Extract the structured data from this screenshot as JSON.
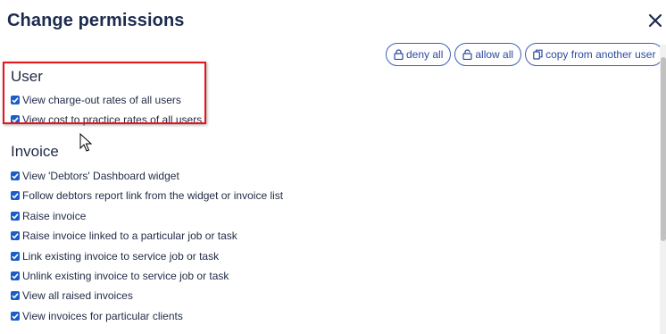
{
  "dialog": {
    "title": "Change permissions",
    "close_icon": "close-icon"
  },
  "toolbar": {
    "deny_all_label": "deny all",
    "allow_all_label": "allow all",
    "copy_label": "copy from another user"
  },
  "sections": [
    {
      "heading": "User",
      "items": [
        {
          "label": "View charge-out rates of all users",
          "checked": true
        },
        {
          "label": "View cost to practice rates of all users",
          "checked": true
        }
      ]
    },
    {
      "heading": "Invoice",
      "items": [
        {
          "label": "View 'Debtors' Dashboard widget",
          "checked": true
        },
        {
          "label": "Follow debtors report link from the widget or invoice list",
          "checked": true
        },
        {
          "label": "Raise invoice",
          "checked": true
        },
        {
          "label": "Raise invoice linked to a particular job or task",
          "checked": true
        },
        {
          "label": "Link existing invoice to service job or task",
          "checked": true
        },
        {
          "label": "Unlink existing invoice to service job or task",
          "checked": true
        },
        {
          "label": "View all raised invoices",
          "checked": true
        },
        {
          "label": "View invoices for particular clients",
          "checked": true
        }
      ]
    }
  ],
  "colors": {
    "accent": "#2b4aa0",
    "checkbox": "#1a5cc8",
    "highlight": "#e8141c"
  }
}
